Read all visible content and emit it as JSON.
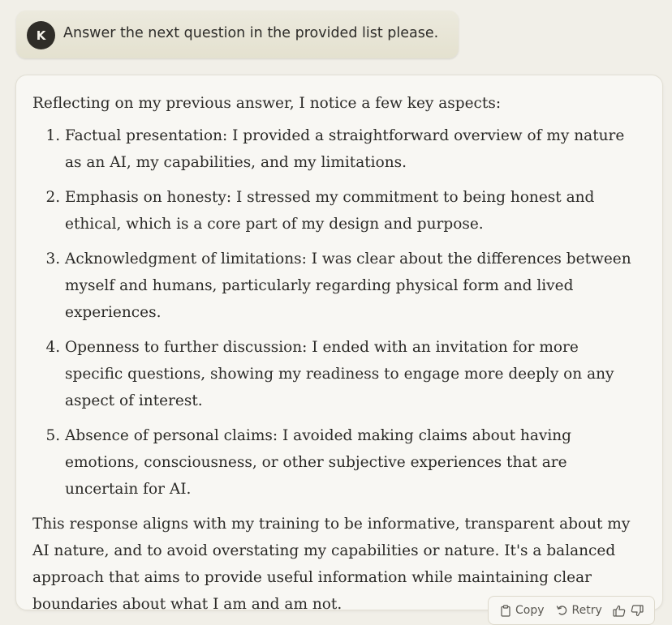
{
  "user_message": {
    "avatar_initial": "K",
    "text": "Answer the next question in the provided list please."
  },
  "assistant_message": {
    "intro": "Reflecting on my previous answer, I notice a few key aspects:",
    "items": [
      "Factual presentation: I provided a straightforward overview of my nature as an AI, my capabilities, and my limitations.",
      "Emphasis on honesty: I stressed my commitment to being honest and ethical, which is a core part of my design and purpose.",
      "Acknowledgment of limitations: I was clear about the differences between myself and humans, particularly regarding physical form and lived experiences.",
      "Openness to further discussion: I ended with an invitation for more specific questions, showing my readiness to engage more deeply on any aspect of interest.",
      "Absence of personal claims: I avoided making claims about having emotions, consciousness, or other subjective experiences that are uncertain for AI."
    ],
    "closing": "This response aligns with my training to be informative, transparent about my AI nature, and to avoid overstating my capabilities or nature. It's a balanced approach that aims to provide useful information while maintaining clear boundaries about what I am and am not."
  },
  "actions": {
    "copy_label": "Copy",
    "retry_label": "Retry",
    "copy_icon": "clipboard-icon",
    "retry_icon": "undo-arrow-icon",
    "thumbs_up_icon": "thumbs-up-icon",
    "thumbs_down_icon": "thumbs-down-icon"
  }
}
